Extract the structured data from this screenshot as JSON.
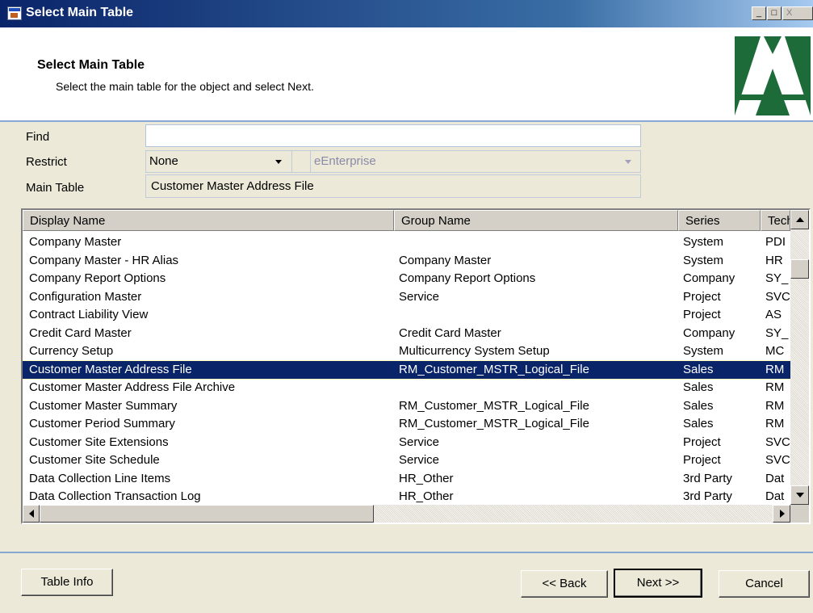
{
  "window": {
    "title": "Select Main Table",
    "controls": [
      "_",
      "□",
      "X"
    ]
  },
  "header": {
    "title": "Select Main Table",
    "subtitle": "Select the main table for the object and select Next."
  },
  "form": {
    "find_label": "Find",
    "find_value": "",
    "restrict_label": "Restrict",
    "restrict_value": "None",
    "restrict_scope": "eEnterprise",
    "main_table_label": "Main Table",
    "main_table_value": "Customer Master Address File"
  },
  "grid": {
    "columns": [
      "Display Name",
      "Group Name",
      "Series",
      "Technical Name"
    ],
    "rows": [
      [
        "Company Master",
        "",
        "System",
        "PDI"
      ],
      [
        "Company Master - HR Alias",
        "Company Master",
        "System",
        "HR"
      ],
      [
        "Company Report Options",
        "Company Report Options",
        "Company",
        "SY_"
      ],
      [
        "Configuration Master",
        "Service",
        "Project",
        "SVC"
      ],
      [
        "Contract Liability View",
        "",
        "Project",
        "AS"
      ],
      [
        "Credit Card Master",
        "Credit Card Master",
        "Company",
        "SY_"
      ],
      [
        "Currency Setup",
        "Multicurrency System Setup",
        "System",
        "MC"
      ],
      [
        "Customer Master Address File",
        "RM_Customer_MSTR_Logical_File",
        "Sales",
        "RM"
      ],
      [
        "Customer Master Address File Archive",
        "",
        "Sales",
        "RM"
      ],
      [
        "Customer Master Summary",
        "RM_Customer_MSTR_Logical_File",
        "Sales",
        "RM"
      ],
      [
        "Customer Period Summary",
        "RM_Customer_MSTR_Logical_File",
        "Sales",
        "RM"
      ],
      [
        "Customer Site Extensions",
        "Service",
        "Project",
        "SVC"
      ],
      [
        "Customer Site Schedule",
        "Service",
        "Project",
        "SVC"
      ],
      [
        "Data Collection Line Items",
        "HR_Other",
        "3rd Party",
        "Dat"
      ],
      [
        "Data Collection Transaction Log",
        "HR_Other",
        "3rd Party",
        "Dat"
      ]
    ],
    "selected_row": 7
  },
  "buttons": {
    "table_info": "Table Info",
    "back": "<< Back",
    "next": "Next >>",
    "cancel": "Cancel"
  },
  "colors": {
    "title_bar": "#0a246a",
    "selection": "#0a246a",
    "logo": "#1e6b3a",
    "dialog_bg": "#ece9d8"
  }
}
